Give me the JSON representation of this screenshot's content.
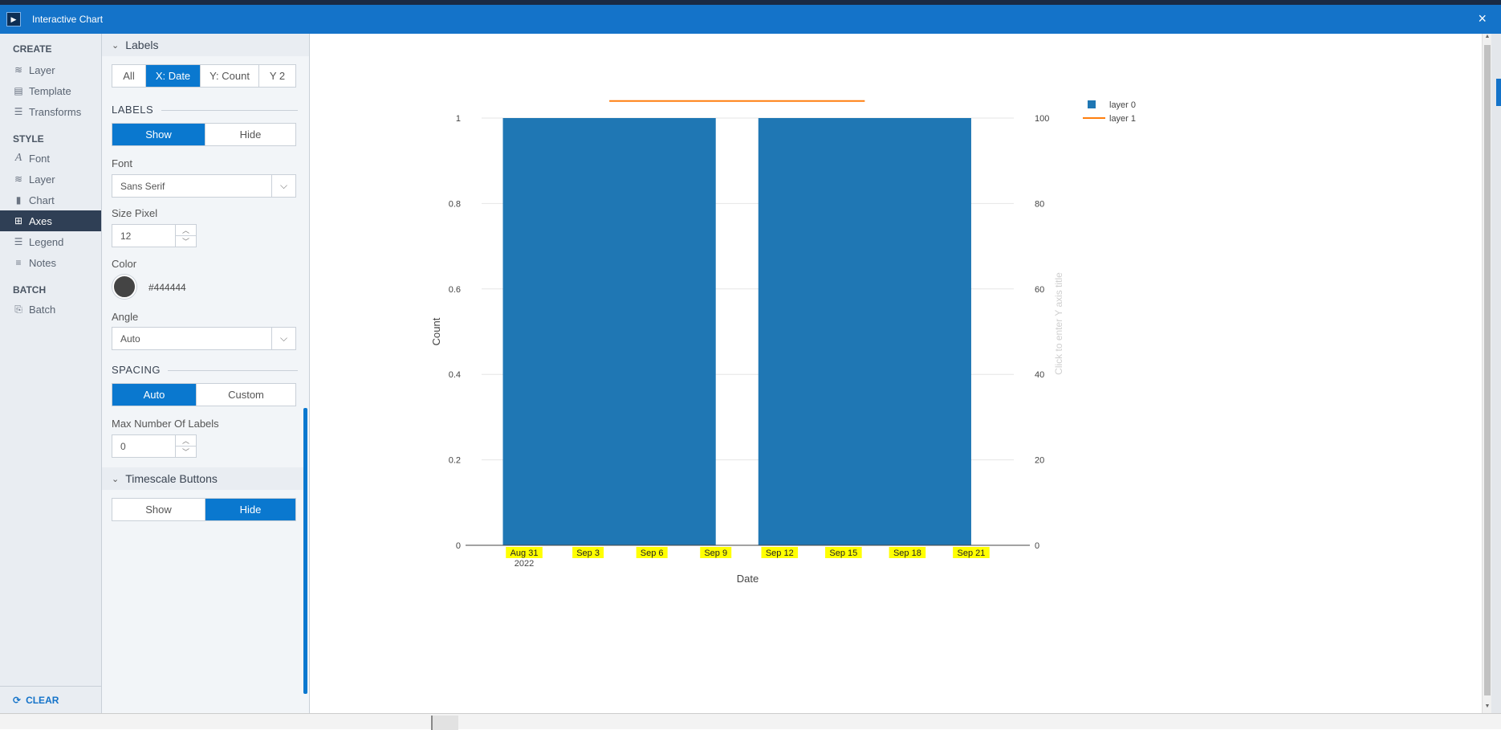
{
  "window": {
    "title": "Interactive Chart",
    "close_label": "×",
    "app_icon_glyph": "▶"
  },
  "leftnav": {
    "sections": {
      "create": "CREATE",
      "style": "STYLE",
      "batch": "BATCH"
    },
    "items": {
      "layer": "Layer",
      "template": "Template",
      "transforms": "Transforms",
      "font": "Font",
      "style_layer": "Layer",
      "chart": "Chart",
      "axes": "Axes",
      "legend": "Legend",
      "notes": "Notes",
      "batch": "Batch"
    },
    "clear_label": "CLEAR",
    "active_item": "Axes"
  },
  "panel": {
    "labels_section_title": "Labels",
    "axis_tabs": [
      "All",
      "X: Date",
      "Y: Count",
      "Y 2"
    ],
    "axis_tab_selected": "X: Date",
    "labels_heading": "LABELS",
    "labels_toggle": [
      "Show",
      "Hide"
    ],
    "labels_toggle_selected": "Show",
    "font_label": "Font",
    "font_value": "Sans Serif",
    "size_label": "Size Pixel",
    "size_value": "12",
    "color_label": "Color",
    "color_value": "#444444",
    "angle_label": "Angle",
    "angle_value": "Auto",
    "spacing_heading": "SPACING",
    "spacing_toggle": [
      "Auto",
      "Custom"
    ],
    "spacing_toggle_selected": "Auto",
    "max_labels_label": "Max Number Of Labels",
    "max_labels_value": "0",
    "timescale_section_title": "Timescale Buttons",
    "timescale_toggle": [
      "Show",
      "Hide"
    ],
    "timescale_toggle_selected": "Hide"
  },
  "colors": {
    "accent": "#0a78cf",
    "titlebar": "#1473c9",
    "bar": "#1f77b4",
    "line": "#ff7f0e",
    "highlight": "#ffff00"
  },
  "chart_data": {
    "type": "bar",
    "xlabel": "Date",
    "ylabel": "Count",
    "y2label_placeholder": "Click to enter Y axis title",
    "ylim": [
      0,
      1
    ],
    "y2lim": [
      0,
      100
    ],
    "y_ticks": [
      "0",
      "0.2",
      "0.4",
      "0.6",
      "0.8",
      "1"
    ],
    "y2_ticks": [
      "0",
      "20",
      "40",
      "60",
      "80",
      "100"
    ],
    "x_tick_labels": [
      "Aug 31",
      "Sep 3",
      "Sep 6",
      "Sep 9",
      "Sep 12",
      "Sep 15",
      "Sep 18",
      "Sep 21"
    ],
    "x_tick_year": "2022",
    "x_range": [
      "2022-08-29",
      "2022-09-23"
    ],
    "series": [
      {
        "name": "layer 0",
        "kind": "bar",
        "axis": "y",
        "bars": [
          {
            "start": "2022-08-30",
            "end": "2022-09-09",
            "value": 1
          },
          {
            "start": "2022-09-11",
            "end": "2022-09-21",
            "value": 1
          }
        ]
      },
      {
        "name": "layer 1",
        "kind": "line",
        "axis": "y2",
        "points": [
          {
            "x": "2022-09-04",
            "y": 104
          },
          {
            "x": "2022-09-16",
            "y": 104
          }
        ]
      }
    ],
    "legend_position": "top-right",
    "grid": true
  }
}
